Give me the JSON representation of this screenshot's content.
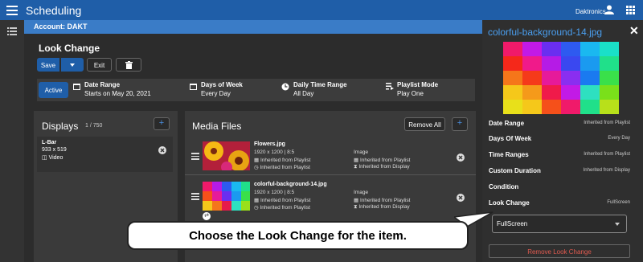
{
  "app": {
    "title": "Scheduling",
    "user": "Daktronics"
  },
  "account": {
    "label": "Account: DAKT"
  },
  "page": {
    "title": "Look Change",
    "save_label": "Save",
    "exit_label": "Exit"
  },
  "summary": {
    "status": "Active",
    "items": [
      {
        "label": "Date Range",
        "value": "Starts on May 20, 2021"
      },
      {
        "label": "Days of Week",
        "value": "Every Day"
      },
      {
        "label": "Daily Time Range",
        "value": "All Day"
      },
      {
        "label": "Playlist Mode",
        "value": "Play One"
      }
    ]
  },
  "displays": {
    "title": "Displays",
    "count": "1 / 750",
    "items": [
      {
        "name": "L-Bar",
        "size": "933 x 519",
        "type": "Video"
      }
    ]
  },
  "media": {
    "title": "Media Files",
    "remove_all": "Remove All",
    "files": [
      {
        "name": "Flowers.jpg",
        "res": "1920 x 1200 | 8:5",
        "line1": "Inherited from Playlist",
        "line2": "Inherited from Playlist",
        "kind": "Image",
        "line3": "Inherited from Playlist",
        "line4": "Inherited from Display"
      },
      {
        "name": "colorful-background-14.jpg",
        "res": "1920 x 1200 | 8:5",
        "line1": "Inherited from Playlist",
        "line2": "Inherited from Playlist",
        "kind": "Image",
        "line3": "Inherited from Playlist",
        "line4": "Inherited from Display"
      }
    ]
  },
  "side": {
    "filename": "colorful-background-14.jpg",
    "props": [
      {
        "label": "Date Range",
        "value": "Inherited from Playlist"
      },
      {
        "label": "Days Of Week",
        "value": "Every Day"
      },
      {
        "label": "Time Ranges",
        "value": "Inherited from Playlist"
      },
      {
        "label": "Custom Duration",
        "value": "Inherited from Display"
      },
      {
        "label": "Condition",
        "value": ""
      },
      {
        "label": "Look Change",
        "value": "FullScreen"
      }
    ],
    "select_value": "FullScreen",
    "remove_label": "Remove Look Change"
  },
  "tooltip": {
    "text": "Choose the Look Change for the item."
  },
  "colors": {
    "topbar": "#1f5ea8",
    "account_bar": "#3a7cc7",
    "remove_text": "#e05a4f"
  }
}
